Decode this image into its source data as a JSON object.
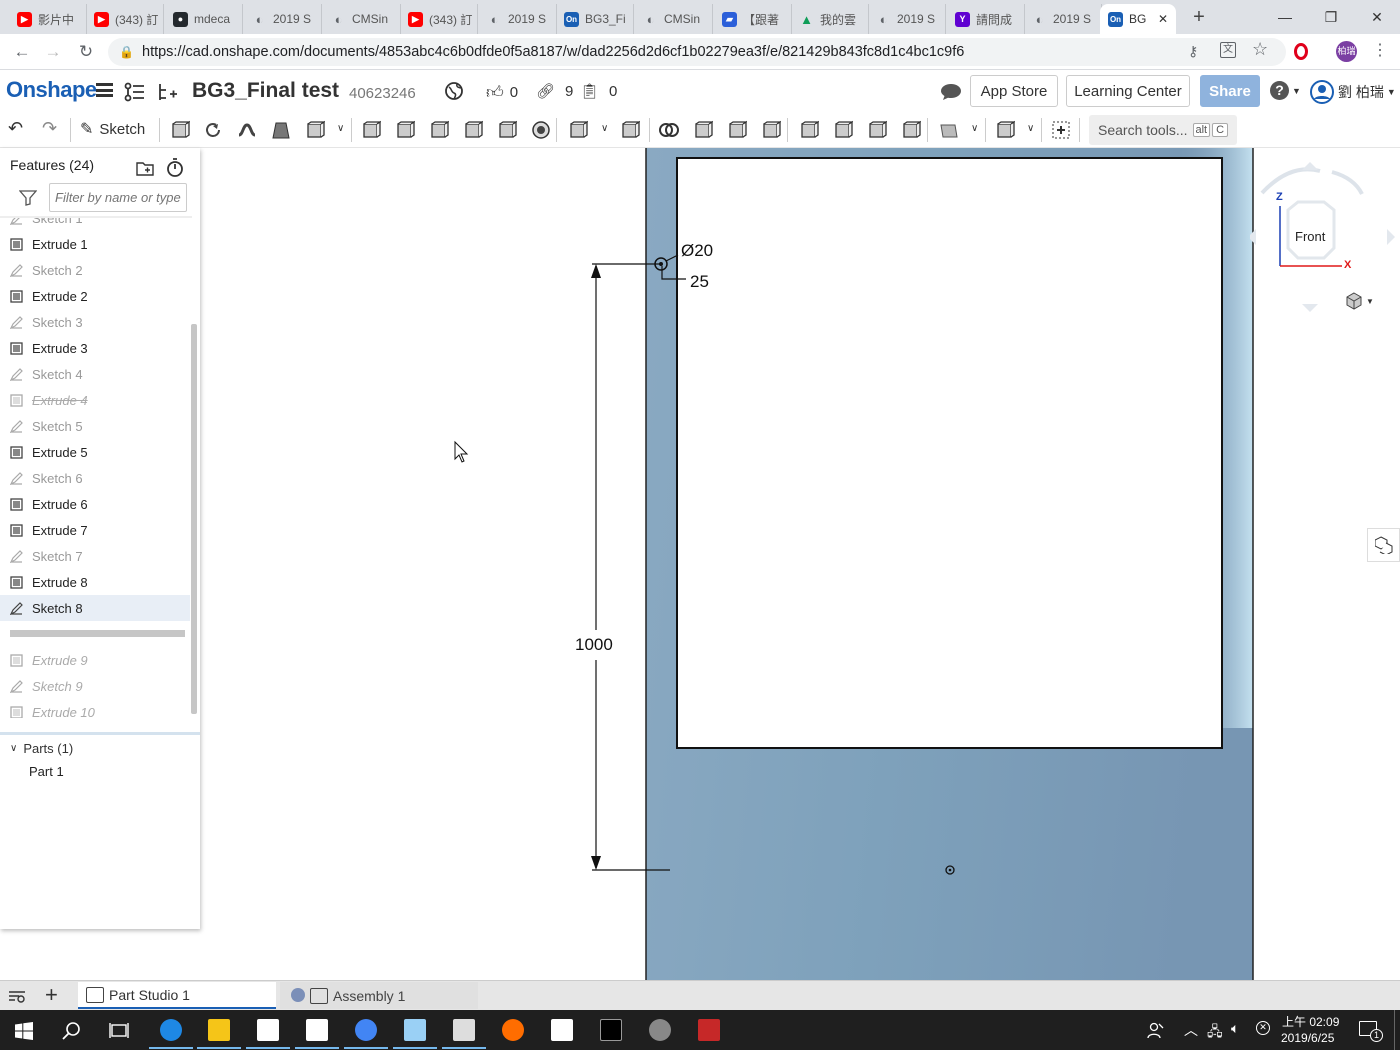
{
  "browser": {
    "tabs": [
      {
        "label": "影片中",
        "fav": "youtube-icon",
        "color": "#ff0000"
      },
      {
        "label": "(343) 訂",
        "fav": "youtube-icon",
        "color": "#ff0000"
      },
      {
        "label": "mdeca",
        "fav": "github-icon",
        "color": "#24292e"
      },
      {
        "label": "2019 S",
        "fav": "globe-icon",
        "color": "#5f6368"
      },
      {
        "label": "CMSin",
        "fav": "globe-icon",
        "color": "#5f6368"
      },
      {
        "label": "(343) 訂",
        "fav": "youtube-icon",
        "color": "#ff0000"
      },
      {
        "label": "2019 S",
        "fav": "globe-icon",
        "color": "#5f6368"
      },
      {
        "label": "BG3_Fi",
        "fav": "onshape-icon",
        "color": "#1a5fb4"
      },
      {
        "label": "CMSin",
        "fav": "globe-icon",
        "color": "#5f6368"
      },
      {
        "label": "【跟著",
        "fav": "chat-icon",
        "color": "#2b5fd9"
      },
      {
        "label": "我的雲",
        "fav": "drive-icon",
        "color": "#0f9d58"
      },
      {
        "label": "2019 S",
        "fav": "globe-icon",
        "color": "#5f6368"
      },
      {
        "label": "請問成",
        "fav": "yahoo-icon",
        "color": "#5f01d1"
      },
      {
        "label": "2019 S",
        "fav": "globe-icon",
        "color": "#5f6368"
      },
      {
        "label": "BG",
        "fav": "onshape-icon",
        "color": "#1a5fb4"
      }
    ],
    "url": "https://cad.onshape.com/documents/4853abc4c6b0dfde0f5a8187/w/dad2256d2d6cf1b02279ea3f/e/821429b843fc8d1c4bc1c9f6",
    "profile": "柏瑞"
  },
  "onshape": {
    "logo": "Onshape",
    "doc_title": "BG3_Final test",
    "doc_id": "40623246",
    "likes": "0",
    "links": "9",
    "copies": "0",
    "app_store": "App Store",
    "learning_center": "Learning Center",
    "share": "Share",
    "user": "劉 柏瑞",
    "sketch_label": "Sketch",
    "search_tools": "Search tools...",
    "shortcut_alt": "alt",
    "shortcut_c": "C"
  },
  "features": {
    "header": "Features (24)",
    "filter_placeholder": "Filter by name or type",
    "items": [
      {
        "label": "Sketch 1",
        "kind": "sketch",
        "state": "clipped"
      },
      {
        "label": "Extrude 1",
        "kind": "extrude",
        "state": "normal"
      },
      {
        "label": "Sketch 2",
        "kind": "sketch",
        "state": "dim"
      },
      {
        "label": "Extrude 2",
        "kind": "extrude",
        "state": "normal"
      },
      {
        "label": "Sketch 3",
        "kind": "sketch",
        "state": "dim"
      },
      {
        "label": "Extrude 3",
        "kind": "extrude",
        "state": "normal"
      },
      {
        "label": "Sketch 4",
        "kind": "sketch",
        "state": "dim"
      },
      {
        "label": "Extrude 4",
        "kind": "extrude",
        "state": "suppressed"
      },
      {
        "label": "Sketch 5",
        "kind": "sketch",
        "state": "dim"
      },
      {
        "label": "Extrude 5",
        "kind": "extrude",
        "state": "normal"
      },
      {
        "label": "Sketch 6",
        "kind": "sketch",
        "state": "dim"
      },
      {
        "label": "Extrude 6",
        "kind": "extrude",
        "state": "normal"
      },
      {
        "label": "Extrude 7",
        "kind": "extrude",
        "state": "normal"
      },
      {
        "label": "Sketch 7",
        "kind": "sketch",
        "state": "dim"
      },
      {
        "label": "Extrude 8",
        "kind": "extrude",
        "state": "normal"
      },
      {
        "label": "Sketch 8",
        "kind": "sketch",
        "state": "selected"
      },
      {
        "label": "Extrude 9",
        "kind": "extrude",
        "state": "rolledback"
      },
      {
        "label": "Sketch 9",
        "kind": "sketch",
        "state": "rolledback"
      },
      {
        "label": "Extrude 10",
        "kind": "extrude",
        "state": "rolledback"
      }
    ],
    "parts_header": "Parts (1)",
    "parts": [
      "Part 1"
    ]
  },
  "viewport": {
    "dim_diameter": "Ø20",
    "dim_offset": "25",
    "dim_height": "1000",
    "view_cube": "Front",
    "axis_z": "Z",
    "axis_x": "X"
  },
  "bottom_tabs": [
    {
      "label": "Part Studio 1",
      "active": true
    },
    {
      "label": "Assembly 1",
      "active": false
    }
  ],
  "taskbar": {
    "time": "上午 02:09",
    "date": "2019/6/25",
    "notif": "1"
  }
}
